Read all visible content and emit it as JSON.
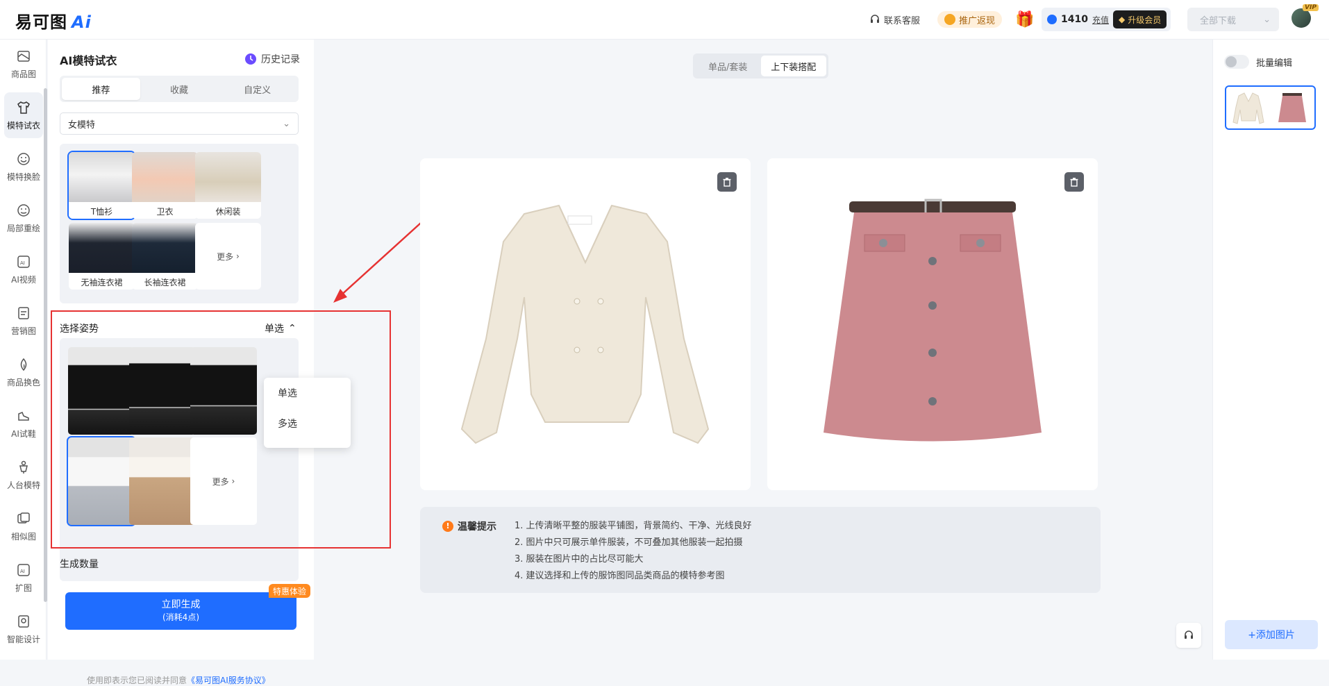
{
  "app": {
    "logo_text": "易可图",
    "logo_ai": "Ai"
  },
  "topbar": {
    "support": "联系客服",
    "promo": "推广返现",
    "points": "1410",
    "recharge": "充值",
    "upgrade": "升级会员",
    "download_all": "全部下载",
    "vip_tag": "VIP"
  },
  "leftnav": {
    "items": [
      {
        "label": "商品图",
        "icon": "image-icon"
      },
      {
        "label": "模特试衣",
        "icon": "tshirt-icon"
      },
      {
        "label": "模特换脸",
        "icon": "face-icon"
      },
      {
        "label": "局部重绘",
        "icon": "face-edit-icon"
      },
      {
        "label": "AI视频",
        "icon": "video-icon"
      },
      {
        "label": "营销图",
        "icon": "poster-icon"
      },
      {
        "label": "商品换色",
        "icon": "color-drop-icon"
      },
      {
        "label": "AI试鞋",
        "icon": "shoe-icon"
      },
      {
        "label": "人台模特",
        "icon": "mannequin-icon"
      },
      {
        "label": "相似图",
        "icon": "similar-icon"
      },
      {
        "label": "扩图",
        "icon": "expand-icon"
      },
      {
        "label": "智能设计",
        "icon": "design-icon"
      }
    ]
  },
  "panel": {
    "title": "AI模特试衣",
    "history": "历史记录",
    "tabs": [
      {
        "label": "推荐"
      },
      {
        "label": "收藏"
      },
      {
        "label": "自定义"
      }
    ],
    "model_type": "女模特",
    "categories": [
      {
        "label": "T恤衫"
      },
      {
        "label": "卫衣"
      },
      {
        "label": "休闲装"
      },
      {
        "label": "无袖连衣裙"
      },
      {
        "label": "长袖连衣裙"
      }
    ],
    "more_label": "更多",
    "pose_title": "选择姿势",
    "pose_mode": "单选",
    "pose_options": [
      {
        "label": "单选"
      },
      {
        "label": "多选"
      }
    ],
    "count_title": "生成数量",
    "generate_label": "立即生成",
    "generate_cost": "(消耗4点)",
    "badge": "特惠体验",
    "agreement_prefix": "使用即表示您已阅读并同意",
    "agreement_link": "《易可图AI服务协议》"
  },
  "main": {
    "segments": [
      {
        "label": "单品/套装"
      },
      {
        "label": "上下装搭配"
      }
    ],
    "tips_title": "温馨提示",
    "tips": [
      "1. 上传清晰平整的服装平铺图，背景简约、干净、光线良好",
      "2. 图片中只可展示单件服装，不可叠加其他服装一起拍摄",
      "3. 服装在图片中的占比尽可能大",
      "4. 建议选择和上传的服饰图同品类商品的模特参考图"
    ]
  },
  "right": {
    "batch_edit": "批量编辑",
    "add_image": "+添加图片"
  },
  "colors": {
    "accent": "#1f6dff",
    "highlight_box": "#e63232",
    "badge": "#ff8a1f"
  }
}
